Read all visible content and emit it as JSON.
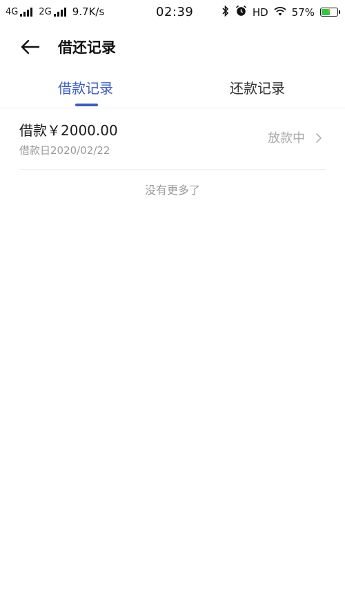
{
  "status_bar": {
    "net1": "4G",
    "net2": "2G",
    "speed": "9.7K/s",
    "time": "02:39",
    "hd": "HD",
    "battery": "57%",
    "battery_level": 0.57,
    "battery_color": "#33c24d"
  },
  "header": {
    "back_icon": "arrow-left-icon",
    "title": "借还记录"
  },
  "tabs": [
    {
      "label": "借款记录",
      "active": true
    },
    {
      "label": "还款记录",
      "active": false
    }
  ],
  "accent_color": "#3d5cb8",
  "records": [
    {
      "amount": "借款￥2000.00",
      "date": "借款日2020/02/22",
      "status": "放款中"
    }
  ],
  "footer_text": "没有更多了"
}
